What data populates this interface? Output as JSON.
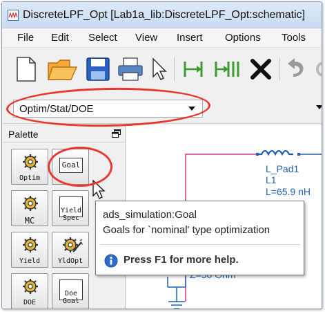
{
  "window": {
    "title": "DiscreteLPF_Opt [Lab1a_lib:DiscreteLPF_Opt:schematic]",
    "app_icon": "schematic-window-icon"
  },
  "menubar": {
    "items": [
      "File",
      "Edit",
      "Select",
      "View",
      "Insert",
      "Options",
      "Tools"
    ]
  },
  "toolbar": {
    "icons": [
      "new-document-icon",
      "open-folder-icon",
      "save-icon",
      "print-icon",
      "select-arrow-icon",
      "insert-pin-icon",
      "insert-wire-icon",
      "delete-icon",
      "undo-icon"
    ]
  },
  "combo": {
    "value": "Optim/Stat/DOE"
  },
  "palette": {
    "title": "Palette",
    "items": [
      {
        "label": "Optim",
        "icon": "gear-icon"
      },
      {
        "label": "Goal",
        "icon": "goal-box-icon"
      },
      {
        "label": "MC",
        "icon": "gear-icon"
      },
      {
        "label": "Yield\nSpec",
        "icon": "yield-spec-box-icon"
      },
      {
        "label": "Yield",
        "icon": "gear-icon"
      },
      {
        "label": "YldOpt",
        "icon": "gear-wand-icon"
      },
      {
        "label": "DOE",
        "icon": "gear-icon"
      },
      {
        "label": "Doe\nGoal",
        "icon": "doe-goal-box-icon"
      }
    ]
  },
  "canvas": {
    "component": {
      "name": "L_Pad1",
      "ref": "L1",
      "value": "L=65.9 nH"
    },
    "source_text": "Z=50 Ohm"
  },
  "tooltip": {
    "title": "ads_simulation:Goal",
    "description": "Goals for `nominal' type optimization",
    "help": "Press F1 for more help."
  },
  "colors": {
    "annotation": "#e8382e",
    "wire": "#d4338a",
    "component": "#1f5fb5"
  }
}
